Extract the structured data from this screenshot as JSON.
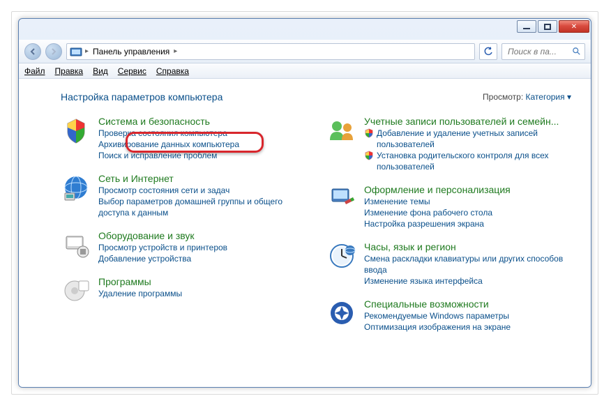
{
  "breadcrumb": {
    "root": "Панель управления"
  },
  "search": {
    "placeholder": "Поиск в па..."
  },
  "menu": {
    "file": "Файл",
    "edit": "Правка",
    "view": "Вид",
    "tools": "Сервис",
    "help": "Справка"
  },
  "header": {
    "title": "Настройка параметров компьютера",
    "view_label": "Просмотр:",
    "view_value": "Категория"
  },
  "left": [
    {
      "title": "Система и безопасность",
      "subs": [
        {
          "text": "Проверка состояния компьютера",
          "shield": false
        },
        {
          "text": "Архивирование данных компьютера",
          "shield": false
        },
        {
          "text": "Поиск и исправление проблем",
          "shield": false
        }
      ]
    },
    {
      "title": "Сеть и Интернет",
      "subs": [
        {
          "text": "Просмотр состояния сети и задач",
          "shield": false
        },
        {
          "text": "Выбор параметров домашней группы и общего доступа к данным",
          "shield": false
        }
      ]
    },
    {
      "title": "Оборудование и звук",
      "subs": [
        {
          "text": "Просмотр устройств и принтеров",
          "shield": false
        },
        {
          "text": "Добавление устройства",
          "shield": false
        }
      ]
    },
    {
      "title": "Программы",
      "subs": [
        {
          "text": "Удаление программы",
          "shield": false
        }
      ]
    }
  ],
  "right": [
    {
      "title": "Учетные записи пользователей и семейн...",
      "subs": [
        {
          "text": "Добавление и удаление учетных записей пользователей",
          "shield": true
        },
        {
          "text": "Установка родительского контроля для всех пользователей",
          "shield": true
        }
      ]
    },
    {
      "title": "Оформление и персонализация",
      "subs": [
        {
          "text": "Изменение темы",
          "shield": false
        },
        {
          "text": "Изменение фона рабочего стола",
          "shield": false
        },
        {
          "text": "Настройка разрешения экрана",
          "shield": false
        }
      ]
    },
    {
      "title": "Часы, язык и регион",
      "subs": [
        {
          "text": "Смена раскладки клавиатуры или других способов ввода",
          "shield": false
        },
        {
          "text": "Изменение языка интерфейса",
          "shield": false
        }
      ]
    },
    {
      "title": "Специальные возможности",
      "subs": [
        {
          "text": "Рекомендуемые Windows параметры",
          "shield": false
        },
        {
          "text": "Оптимизация изображения на экране",
          "shield": false
        }
      ]
    }
  ]
}
